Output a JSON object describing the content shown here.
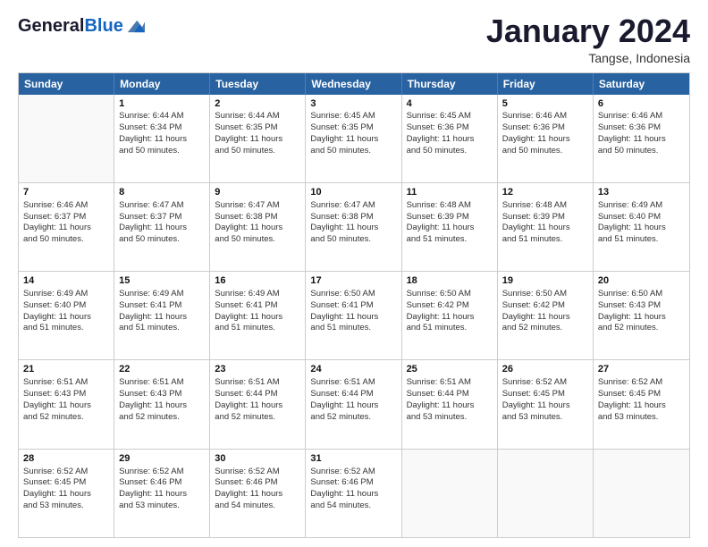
{
  "header": {
    "logo_general": "General",
    "logo_blue": "Blue",
    "month_title": "January 2024",
    "subtitle": "Tangse, Indonesia"
  },
  "columns": [
    "Sunday",
    "Monday",
    "Tuesday",
    "Wednesday",
    "Thursday",
    "Friday",
    "Saturday"
  ],
  "rows": [
    [
      {
        "day": "",
        "empty": true,
        "lines": []
      },
      {
        "day": "1",
        "empty": false,
        "lines": [
          "Sunrise: 6:44 AM",
          "Sunset: 6:34 PM",
          "Daylight: 11 hours",
          "and 50 minutes."
        ]
      },
      {
        "day": "2",
        "empty": false,
        "lines": [
          "Sunrise: 6:44 AM",
          "Sunset: 6:35 PM",
          "Daylight: 11 hours",
          "and 50 minutes."
        ]
      },
      {
        "day": "3",
        "empty": false,
        "lines": [
          "Sunrise: 6:45 AM",
          "Sunset: 6:35 PM",
          "Daylight: 11 hours",
          "and 50 minutes."
        ]
      },
      {
        "day": "4",
        "empty": false,
        "lines": [
          "Sunrise: 6:45 AM",
          "Sunset: 6:36 PM",
          "Daylight: 11 hours",
          "and 50 minutes."
        ]
      },
      {
        "day": "5",
        "empty": false,
        "lines": [
          "Sunrise: 6:46 AM",
          "Sunset: 6:36 PM",
          "Daylight: 11 hours",
          "and 50 minutes."
        ]
      },
      {
        "day": "6",
        "empty": false,
        "lines": [
          "Sunrise: 6:46 AM",
          "Sunset: 6:36 PM",
          "Daylight: 11 hours",
          "and 50 minutes."
        ]
      }
    ],
    [
      {
        "day": "7",
        "empty": false,
        "lines": [
          "Sunrise: 6:46 AM",
          "Sunset: 6:37 PM",
          "Daylight: 11 hours",
          "and 50 minutes."
        ]
      },
      {
        "day": "8",
        "empty": false,
        "lines": [
          "Sunrise: 6:47 AM",
          "Sunset: 6:37 PM",
          "Daylight: 11 hours",
          "and 50 minutes."
        ]
      },
      {
        "day": "9",
        "empty": false,
        "lines": [
          "Sunrise: 6:47 AM",
          "Sunset: 6:38 PM",
          "Daylight: 11 hours",
          "and 50 minutes."
        ]
      },
      {
        "day": "10",
        "empty": false,
        "lines": [
          "Sunrise: 6:47 AM",
          "Sunset: 6:38 PM",
          "Daylight: 11 hours",
          "and 50 minutes."
        ]
      },
      {
        "day": "11",
        "empty": false,
        "lines": [
          "Sunrise: 6:48 AM",
          "Sunset: 6:39 PM",
          "Daylight: 11 hours",
          "and 51 minutes."
        ]
      },
      {
        "day": "12",
        "empty": false,
        "lines": [
          "Sunrise: 6:48 AM",
          "Sunset: 6:39 PM",
          "Daylight: 11 hours",
          "and 51 minutes."
        ]
      },
      {
        "day": "13",
        "empty": false,
        "lines": [
          "Sunrise: 6:49 AM",
          "Sunset: 6:40 PM",
          "Daylight: 11 hours",
          "and 51 minutes."
        ]
      }
    ],
    [
      {
        "day": "14",
        "empty": false,
        "lines": [
          "Sunrise: 6:49 AM",
          "Sunset: 6:40 PM",
          "Daylight: 11 hours",
          "and 51 minutes."
        ]
      },
      {
        "day": "15",
        "empty": false,
        "lines": [
          "Sunrise: 6:49 AM",
          "Sunset: 6:41 PM",
          "Daylight: 11 hours",
          "and 51 minutes."
        ]
      },
      {
        "day": "16",
        "empty": false,
        "lines": [
          "Sunrise: 6:49 AM",
          "Sunset: 6:41 PM",
          "Daylight: 11 hours",
          "and 51 minutes."
        ]
      },
      {
        "day": "17",
        "empty": false,
        "lines": [
          "Sunrise: 6:50 AM",
          "Sunset: 6:41 PM",
          "Daylight: 11 hours",
          "and 51 minutes."
        ]
      },
      {
        "day": "18",
        "empty": false,
        "lines": [
          "Sunrise: 6:50 AM",
          "Sunset: 6:42 PM",
          "Daylight: 11 hours",
          "and 51 minutes."
        ]
      },
      {
        "day": "19",
        "empty": false,
        "lines": [
          "Sunrise: 6:50 AM",
          "Sunset: 6:42 PM",
          "Daylight: 11 hours",
          "and 52 minutes."
        ]
      },
      {
        "day": "20",
        "empty": false,
        "lines": [
          "Sunrise: 6:50 AM",
          "Sunset: 6:43 PM",
          "Daylight: 11 hours",
          "and 52 minutes."
        ]
      }
    ],
    [
      {
        "day": "21",
        "empty": false,
        "lines": [
          "Sunrise: 6:51 AM",
          "Sunset: 6:43 PM",
          "Daylight: 11 hours",
          "and 52 minutes."
        ]
      },
      {
        "day": "22",
        "empty": false,
        "lines": [
          "Sunrise: 6:51 AM",
          "Sunset: 6:43 PM",
          "Daylight: 11 hours",
          "and 52 minutes."
        ]
      },
      {
        "day": "23",
        "empty": false,
        "lines": [
          "Sunrise: 6:51 AM",
          "Sunset: 6:44 PM",
          "Daylight: 11 hours",
          "and 52 minutes."
        ]
      },
      {
        "day": "24",
        "empty": false,
        "lines": [
          "Sunrise: 6:51 AM",
          "Sunset: 6:44 PM",
          "Daylight: 11 hours",
          "and 52 minutes."
        ]
      },
      {
        "day": "25",
        "empty": false,
        "lines": [
          "Sunrise: 6:51 AM",
          "Sunset: 6:44 PM",
          "Daylight: 11 hours",
          "and 53 minutes."
        ]
      },
      {
        "day": "26",
        "empty": false,
        "lines": [
          "Sunrise: 6:52 AM",
          "Sunset: 6:45 PM",
          "Daylight: 11 hours",
          "and 53 minutes."
        ]
      },
      {
        "day": "27",
        "empty": false,
        "lines": [
          "Sunrise: 6:52 AM",
          "Sunset: 6:45 PM",
          "Daylight: 11 hours",
          "and 53 minutes."
        ]
      }
    ],
    [
      {
        "day": "28",
        "empty": false,
        "lines": [
          "Sunrise: 6:52 AM",
          "Sunset: 6:45 PM",
          "Daylight: 11 hours",
          "and 53 minutes."
        ]
      },
      {
        "day": "29",
        "empty": false,
        "lines": [
          "Sunrise: 6:52 AM",
          "Sunset: 6:46 PM",
          "Daylight: 11 hours",
          "and 53 minutes."
        ]
      },
      {
        "day": "30",
        "empty": false,
        "lines": [
          "Sunrise: 6:52 AM",
          "Sunset: 6:46 PM",
          "Daylight: 11 hours",
          "and 54 minutes."
        ]
      },
      {
        "day": "31",
        "empty": false,
        "lines": [
          "Sunrise: 6:52 AM",
          "Sunset: 6:46 PM",
          "Daylight: 11 hours",
          "and 54 minutes."
        ]
      },
      {
        "day": "",
        "empty": true,
        "lines": []
      },
      {
        "day": "",
        "empty": true,
        "lines": []
      },
      {
        "day": "",
        "empty": true,
        "lines": []
      }
    ]
  ]
}
